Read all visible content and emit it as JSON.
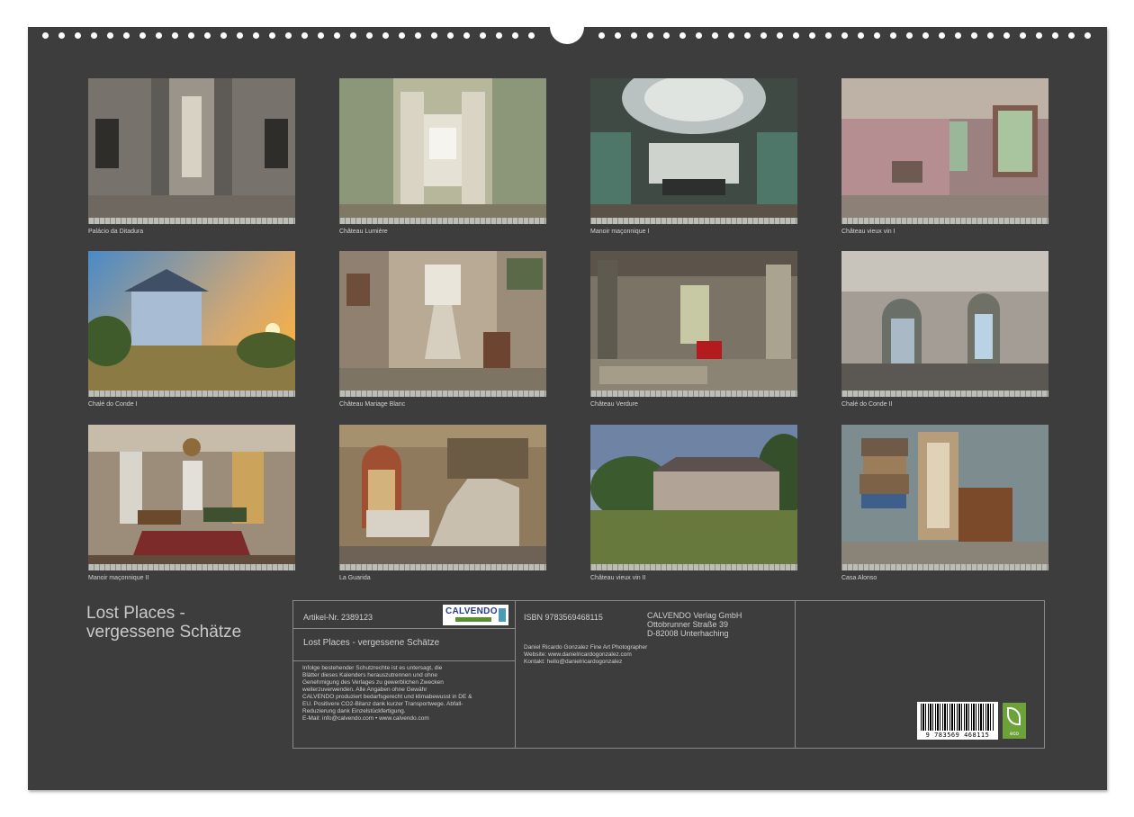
{
  "calendar": {
    "title_line1": "Lost Places -",
    "title_line2": "vergessene Schätze"
  },
  "photos": [
    {
      "caption": "Palácio da Ditadura",
      "icon": "palace-atrium-photo"
    },
    {
      "caption": "Château Lumière",
      "icon": "open-double-doors-photo"
    },
    {
      "caption": "Manoir maçonnique I",
      "icon": "glass-dome-hall-photo"
    },
    {
      "caption": "Château vieux vin I",
      "icon": "pink-room-window-photo"
    },
    {
      "caption": "Chalé do Conde I",
      "icon": "villa-sunset-photo"
    },
    {
      "caption": "Château Mariage Blanc",
      "icon": "staircase-hall-photo"
    },
    {
      "caption": "Château Verdure",
      "icon": "red-chair-ruin-photo"
    },
    {
      "caption": "Chalé do Conde II",
      "icon": "arched-doors-room-photo"
    },
    {
      "caption": "Manoir maçonnique II",
      "icon": "salon-chandelier-photo"
    },
    {
      "caption": "La Guarida",
      "icon": "grand-staircase-photo"
    },
    {
      "caption": "Château vieux vin II",
      "icon": "overgrown-mansion-photo"
    },
    {
      "caption": "Casa Alonso",
      "icon": "suitcase-stack-room-photo"
    }
  ],
  "info": {
    "article_number": "Artikel-Nr. 2389123",
    "publisher_logo_name": "CALVENDO",
    "publisher_logo_tagline": "print",
    "product_title": "Lost Places - vergessene Schätze",
    "legal_lines": [
      "Infolge bestehender Schutzrechte ist es untersagt, die",
      "Blätter dieses Kalenders herauszutrennen und ohne",
      "Genehmigung des Verlages zu gewerblichen Zwecken",
      "weiterzuverwenden. Alle Angaben ohne Gewähr",
      "CALVENDO produziert bedarfsgerecht und klimabewusst in DE &",
      "EU. Positivere CO2-Bilanz dank kurzer Transportwege. Abfall-",
      "Reduzierung dank Einzelstückfertigung.",
      "E-Mail: info@calvendo.com • www.calvendo.com"
    ],
    "isbn": "ISBN 9783569468115",
    "publisher_address": [
      "CALVENDO Verlag GmbH",
      "Ottobrunner Straße 39",
      "D-82008 Unterhaching"
    ],
    "photographer_lines": [
      "Daniel Ricardo Gonzalez Fine Art Photographer",
      "Website: www.danielricardogonzalez.com",
      "Kontakt: hello@danielricardogonzalez"
    ],
    "barcode_number": "9 783569 468115",
    "eco_label": "eco"
  },
  "colors": {
    "background": "#3d3d3d",
    "text": "#d0d0d0",
    "border": "#8a8a8a",
    "eco_green": "#6da23a"
  }
}
